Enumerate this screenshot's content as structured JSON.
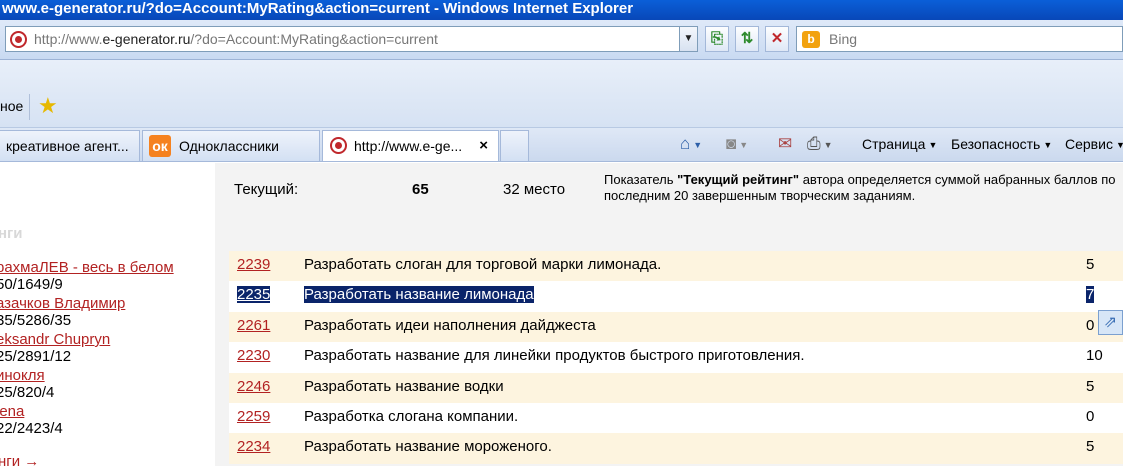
{
  "window": {
    "title": "www.e-generator.ru/?do=Account:MyRating&action=current - Windows Internet Explorer"
  },
  "address_bar": {
    "url_prefix": "http://www.",
    "url_domain": "e-generator.ru",
    "url_suffix": "/?do=Account:MyRating&action=current"
  },
  "search": {
    "placeholder": "Bing"
  },
  "favorites_bar": {
    "left_text": "ное"
  },
  "tabs": [
    {
      "label": "креативное агент..."
    },
    {
      "label": "Одноклассники"
    },
    {
      "label": "http://www.e-ge..."
    }
  ],
  "command_bar": {
    "page": "Страница",
    "safety": "Безопасность",
    "tools": "Сервис"
  },
  "sidebar": {
    "heading": "нги",
    "authors": [
      {
        "name": "рахмаЛЕВ - весь в белом",
        "stats": "50/1649/9"
      },
      {
        "name": "азачков Владимир",
        "stats": "35/5286/35"
      },
      {
        "name": "eksandr Chupryn",
        "stats": "25/2891/12"
      },
      {
        "name": "инокля",
        "stats": "25/820/4"
      },
      {
        "name": "lena",
        "stats": "22/2423/4"
      }
    ],
    "more_link": "нги →"
  },
  "rating": {
    "label": "Текущий:",
    "score": "65",
    "place": "32 место",
    "note_prefix": "Показатель ",
    "note_bold": "\"Текущий рейтинг\"",
    "note_suffix": " автора определяется суммой набранных баллов по последним 20 завершенным творческим заданиям."
  },
  "tasks": [
    {
      "id": "2239",
      "title": "Разработать слоган для торговой марки лимонада.",
      "score": "5"
    },
    {
      "id": "2235",
      "title": "Разработать название лимонада",
      "score": "7"
    },
    {
      "id": "2261",
      "title": "Разработать идеи наполнения дайджеста",
      "score": "0"
    },
    {
      "id": "2230",
      "title": "Разработать название для линейки продуктов быстрого приготовления.",
      "score": "10"
    },
    {
      "id": "2246",
      "title": "Разработать название водки",
      "score": "5"
    },
    {
      "id": "2259",
      "title": "Разработка слогана компании.",
      "score": "0"
    },
    {
      "id": "2234",
      "title": "Разработать название мороженого.",
      "score": "5"
    }
  ]
}
